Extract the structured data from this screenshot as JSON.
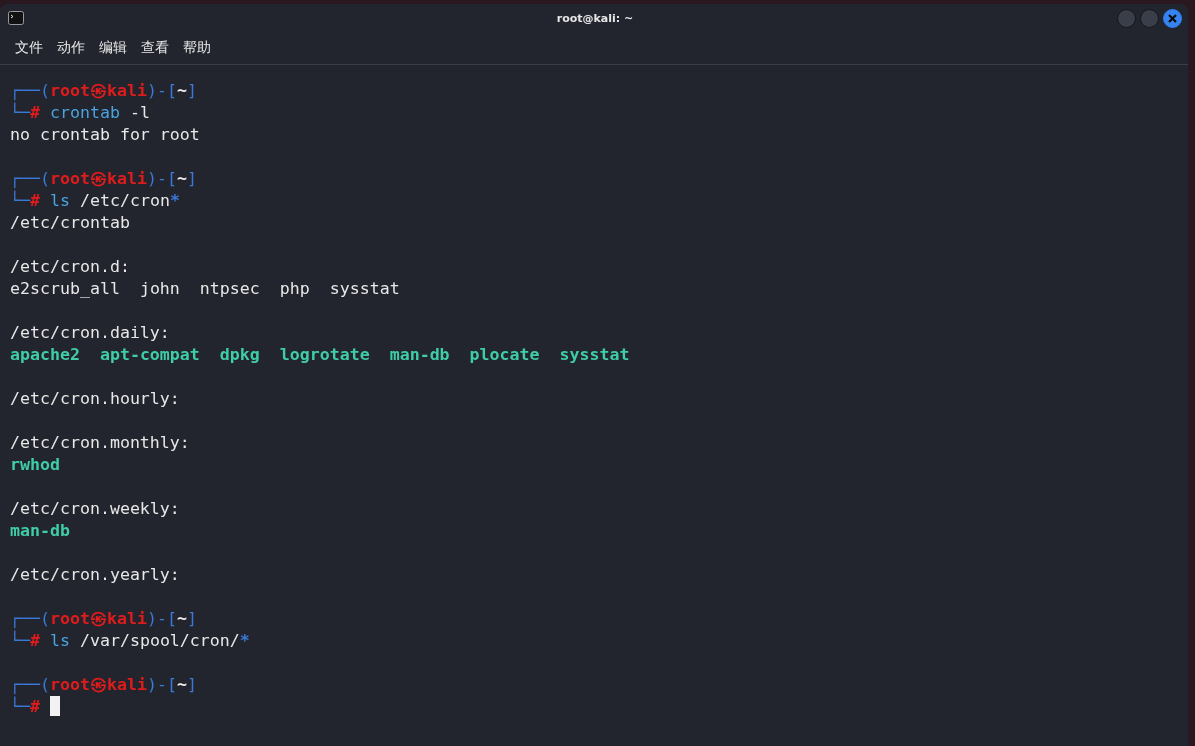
{
  "window": {
    "title": "root@kali: ~"
  },
  "menu": [
    "文件",
    "动作",
    "编辑",
    "查看",
    "帮助"
  ],
  "lines": [
    {
      "kind": "prompt",
      "corner_top": "┌──(",
      "user": "root",
      "at": "㉿",
      "host": "kali",
      "sep": ")-[",
      "dir": "~",
      "close": "]",
      "corner_bottom": "└─",
      "hash": "#",
      "command": "crontab",
      "args": [
        {
          "kind": "plain",
          "text": " -l"
        }
      ]
    },
    {
      "kind": "output",
      "text": "no crontab for root"
    },
    {
      "kind": "blank"
    },
    {
      "kind": "prompt",
      "corner_top": "┌──(",
      "user": "root",
      "at": "㉿",
      "host": "kali",
      "sep": ")-[",
      "dir": "~",
      "close": "]",
      "corner_bottom": "└─",
      "hash": "#",
      "command": "ls",
      "args": [
        {
          "kind": "plain",
          "text": " /etc/cron"
        },
        {
          "kind": "glob",
          "text": "*"
        }
      ]
    },
    {
      "kind": "output",
      "text": "/etc/crontab"
    },
    {
      "kind": "blank"
    },
    {
      "kind": "output",
      "text": "/etc/cron.d:"
    },
    {
      "kind": "listing",
      "items": [
        {
          "text": "e2scrub_all",
          "kind": "file"
        },
        {
          "text": "john",
          "kind": "file"
        },
        {
          "text": "ntpsec",
          "kind": "file"
        },
        {
          "text": "php",
          "kind": "file"
        },
        {
          "text": "sysstat",
          "kind": "file"
        }
      ]
    },
    {
      "kind": "blank"
    },
    {
      "kind": "output",
      "text": "/etc/cron.daily:"
    },
    {
      "kind": "listing",
      "items": [
        {
          "text": "apache2",
          "kind": "exec"
        },
        {
          "text": "apt-compat",
          "kind": "exec"
        },
        {
          "text": "dpkg",
          "kind": "exec"
        },
        {
          "text": "logrotate",
          "kind": "exec"
        },
        {
          "text": "man-db",
          "kind": "exec"
        },
        {
          "text": "plocate",
          "kind": "exec"
        },
        {
          "text": "sysstat",
          "kind": "exec"
        }
      ]
    },
    {
      "kind": "blank"
    },
    {
      "kind": "output",
      "text": "/etc/cron.hourly:"
    },
    {
      "kind": "blank"
    },
    {
      "kind": "output",
      "text": "/etc/cron.monthly:"
    },
    {
      "kind": "listing",
      "items": [
        {
          "text": "rwhod",
          "kind": "exec"
        }
      ]
    },
    {
      "kind": "blank"
    },
    {
      "kind": "output",
      "text": "/etc/cron.weekly:"
    },
    {
      "kind": "listing",
      "items": [
        {
          "text": "man-db",
          "kind": "exec"
        }
      ]
    },
    {
      "kind": "blank"
    },
    {
      "kind": "output",
      "text": "/etc/cron.yearly:"
    },
    {
      "kind": "blank"
    },
    {
      "kind": "prompt",
      "corner_top": "┌──(",
      "user": "root",
      "at": "㉿",
      "host": "kali",
      "sep": ")-[",
      "dir": "~",
      "close": "]",
      "corner_bottom": "└─",
      "hash": "#",
      "command": "ls",
      "args": [
        {
          "kind": "plain",
          "text": " /var/spool/cron/"
        },
        {
          "kind": "glob",
          "text": "*"
        }
      ]
    },
    {
      "kind": "blank"
    },
    {
      "kind": "prompt",
      "corner_top": "┌──(",
      "user": "root",
      "at": "㉿",
      "host": "kali",
      "sep": ")-[",
      "dir": "~",
      "close": "]",
      "corner_bottom": "└─",
      "hash": "#",
      "cursor": true
    }
  ]
}
